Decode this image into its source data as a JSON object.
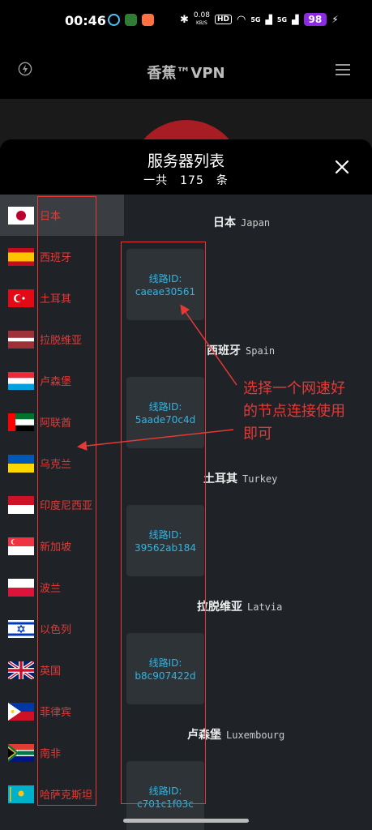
{
  "status_bar": {
    "time": "00:46",
    "speed_value": "0.08",
    "speed_unit": "KB/S",
    "hd_label": "HD",
    "net_label_1": "5G",
    "net_label_2": "5G",
    "battery": "98"
  },
  "app": {
    "title": "香蕉™VPN"
  },
  "sheet": {
    "title": "服务器列表",
    "count_text": "一共　175　条"
  },
  "countries": [
    {
      "name": "日本",
      "flag": "jp"
    },
    {
      "name": "西班牙",
      "flag": "es"
    },
    {
      "name": "土耳其",
      "flag": "tr"
    },
    {
      "name": "拉脱维亚",
      "flag": "lv"
    },
    {
      "name": "卢森堡",
      "flag": "lu"
    },
    {
      "name": "阿联酋",
      "flag": "ae"
    },
    {
      "name": "乌克兰",
      "flag": "ua"
    },
    {
      "name": "印度尼西亚",
      "flag": "id"
    },
    {
      "name": "新加坡",
      "flag": "sg"
    },
    {
      "name": "波兰",
      "flag": "pl"
    },
    {
      "name": "以色列",
      "flag": "il"
    },
    {
      "name": "英国",
      "flag": "gb"
    },
    {
      "name": "菲律宾",
      "flag": "ph"
    },
    {
      "name": "南非",
      "flag": "za"
    },
    {
      "name": "哈萨克斯坦",
      "flag": "kz"
    }
  ],
  "groups": [
    {
      "cn": "日本",
      "en": "Japan",
      "node_label": "线路ID:",
      "node_id": "caeae30561"
    },
    {
      "cn": "西班牙",
      "en": "Spain",
      "node_label": "线路ID:",
      "node_id": "5aade70c4d"
    },
    {
      "cn": "土耳其",
      "en": "Turkey",
      "node_label": "线路ID:",
      "node_id": "39562ab184"
    },
    {
      "cn": "拉脱维亚",
      "en": "Latvia",
      "node_label": "线路ID:",
      "node_id": "b8c907422d"
    },
    {
      "cn": "卢森堡",
      "en": "Luxembourg",
      "node_label": "线路ID:",
      "node_id": "c701c1f03c"
    }
  ],
  "annotation": {
    "line1": "选择一个网速好",
    "line2": "的节点连接使用",
    "line3": "即可"
  },
  "colors": {
    "accent_red": "#e53935",
    "node_text": "#2ab7e8",
    "battery_bg": "#8a2be2"
  }
}
